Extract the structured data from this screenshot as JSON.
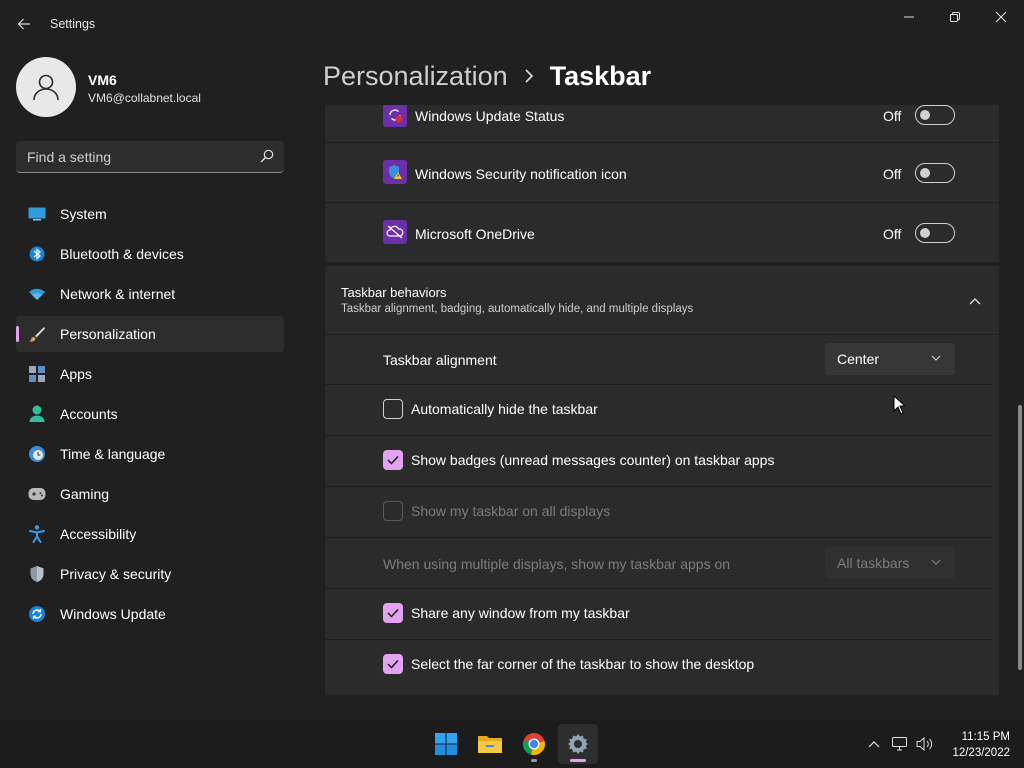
{
  "window": {
    "title": "Settings"
  },
  "profile": {
    "name": "VM6",
    "email": "VM6@collabnet.local"
  },
  "search": {
    "placeholder": "Find a setting"
  },
  "sidebar": {
    "items": [
      {
        "label": "System",
        "icon": "system-icon"
      },
      {
        "label": "Bluetooth & devices",
        "icon": "bluetooth-icon"
      },
      {
        "label": "Network & internet",
        "icon": "wifi-icon"
      },
      {
        "label": "Personalization",
        "icon": "brush-icon",
        "active": true
      },
      {
        "label": "Apps",
        "icon": "apps-icon"
      },
      {
        "label": "Accounts",
        "icon": "accounts-icon"
      },
      {
        "label": "Time & language",
        "icon": "globe-clock-icon"
      },
      {
        "label": "Gaming",
        "icon": "gamepad-icon"
      },
      {
        "label": "Accessibility",
        "icon": "accessibility-icon"
      },
      {
        "label": "Privacy & security",
        "icon": "shield-icon"
      },
      {
        "label": "Windows Update",
        "icon": "update-icon"
      }
    ]
  },
  "header": {
    "parent": "Personalization",
    "current": "Taskbar"
  },
  "tray_apps": [
    {
      "label": "Windows Update Status",
      "state": "Off",
      "icon": "windows-update-status-icon"
    },
    {
      "label": "Windows Security notification icon",
      "state": "Off",
      "icon": "windows-security-icon"
    },
    {
      "label": "Microsoft OneDrive",
      "state": "Off",
      "icon": "onedrive-icon"
    }
  ],
  "behaviors": {
    "title": "Taskbar behaviors",
    "subtitle": "Taskbar alignment, badging, automatically hide, and multiple displays",
    "alignment_label": "Taskbar alignment",
    "alignment_value": "Center",
    "auto_hide": "Automatically hide the taskbar",
    "badges": "Show badges (unread messages counter) on taskbar apps",
    "all_displays": "Show my taskbar on all displays",
    "multi_display_label": "When using multiple displays, show my taskbar apps on",
    "multi_display_value": "All taskbars",
    "share_window": "Share any window from my taskbar",
    "far_corner": "Select the far corner of the taskbar to show the desktop"
  },
  "taskbar": {
    "apps": [
      "start-icon",
      "file-explorer-icon",
      "chrome-icon",
      "settings-icon"
    ],
    "time": "11:15 PM",
    "date": "12/23/2022"
  },
  "colors": {
    "accent": "#e2a3f0",
    "background": "#202020",
    "card": "#2b2b2b"
  }
}
